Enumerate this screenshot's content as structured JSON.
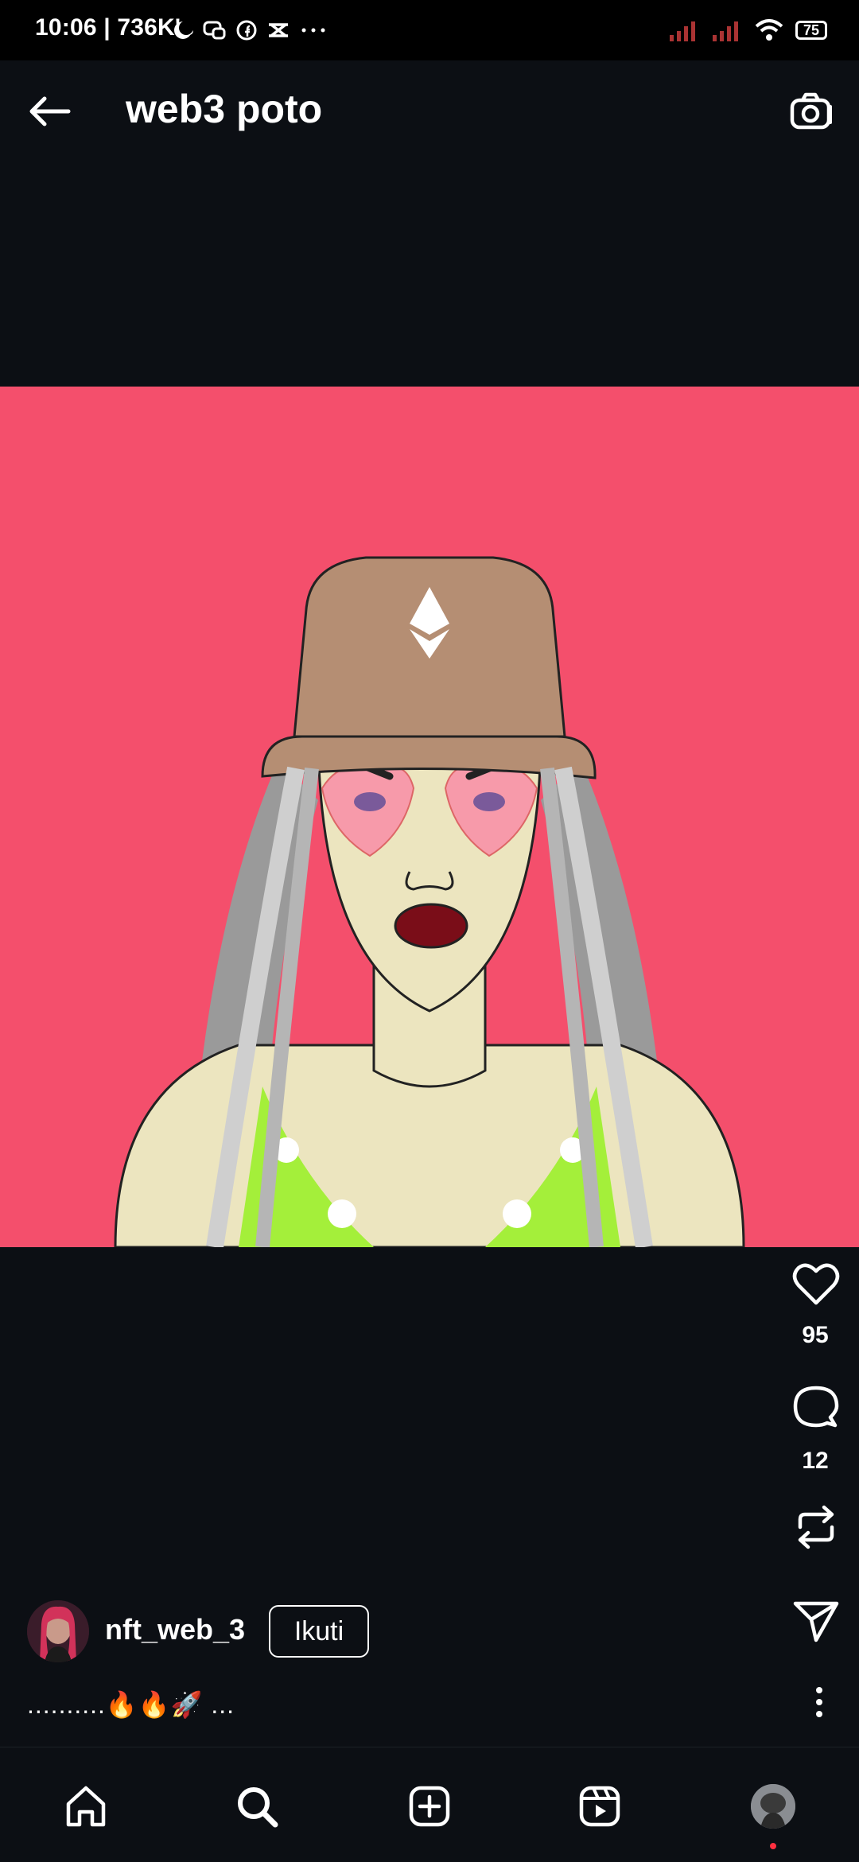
{
  "status_bar": {
    "time": "10:06 | 736K's",
    "battery": "75"
  },
  "header": {
    "title": "web3 poto"
  },
  "actions": {
    "like_count": "95",
    "comment_count": "12"
  },
  "author": {
    "username": "nft_web_3",
    "follow_label": "Ikuti"
  },
  "caption": "..........🔥🔥🚀 ...",
  "icons": {
    "back": "arrow-left-icon",
    "camera": "camera-icon",
    "like": "heart-icon",
    "comment": "comment-icon",
    "repost": "repost-icon",
    "share": "send-icon",
    "more": "more-vertical-icon",
    "home": "home-icon",
    "search": "search-icon",
    "create": "plus-square-icon",
    "reels": "reels-icon",
    "profile": "profile-avatar"
  },
  "colors": {
    "background": "#0c0f14",
    "media_background": "#f44f6c",
    "text": "#ffffff",
    "notification_dot": "#ff3040"
  }
}
